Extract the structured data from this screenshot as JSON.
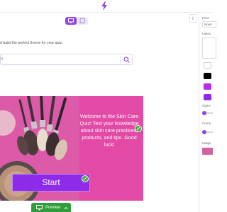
{
  "header": {
    "logo_icon": "flame-bolt-icon",
    "accent": "#8e45e0"
  },
  "view_toggle": {
    "active": "desktop",
    "items": [
      "desktop-icon",
      "mobile-icon"
    ]
  },
  "subtitle": "d build the perfect theme for your quiz.",
  "search": {
    "placeholder": "h",
    "icon": "search-icon"
  },
  "preview_card": {
    "background": "#e24aa6",
    "text": "Welcome to the Skin Care Quiz! Test your knowledge about skin care practices, products, and tips. Good luck!",
    "start_label": "Start",
    "start_color": "#8e2bea"
  },
  "preview_button": {
    "label": "Preview"
  },
  "panel": {
    "font_label": "Font",
    "font_value": "Noss",
    "layout_label": "Layou",
    "colors": [
      "#ffffff",
      "#000000",
      "#b52ee8",
      "#8e2bea"
    ],
    "opacity_label": "Opaci",
    "corner_label": "Corne",
    "image_label": "Image"
  }
}
